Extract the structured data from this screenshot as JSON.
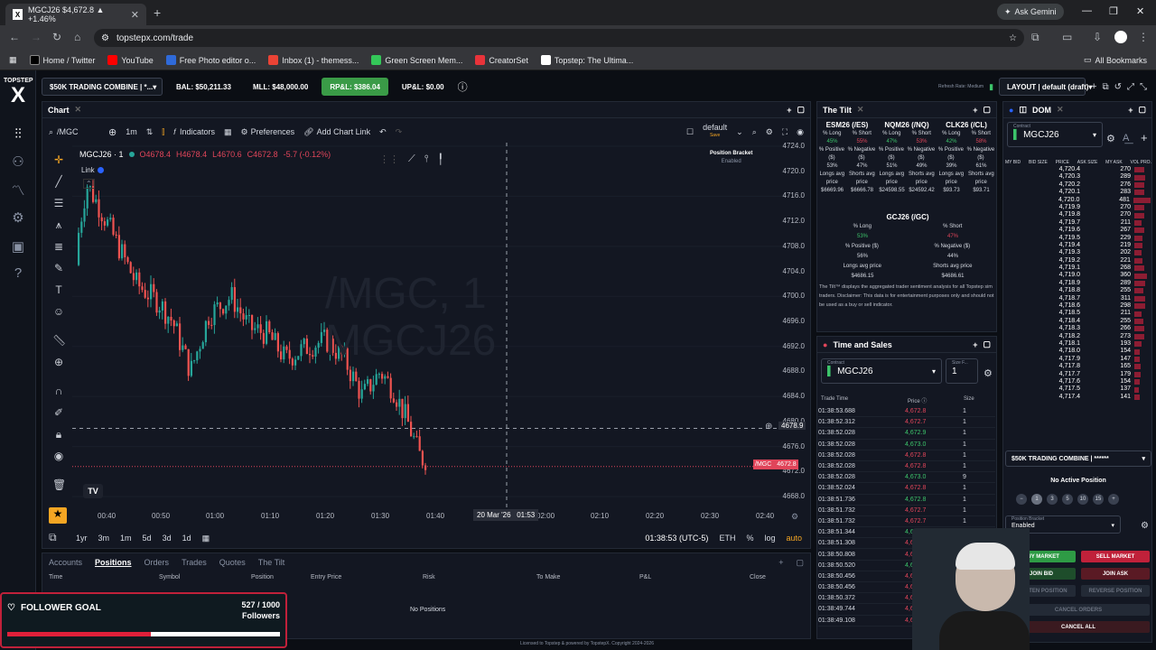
{
  "browser": {
    "tab_title": "MGCJ26 $4,672.8 ▲ +1.46%",
    "tab_icon": "X",
    "ask_gemini": "Ask Gemini",
    "url": "topstepx.com/trade",
    "bookmarks": [
      "Home / Twitter",
      "YouTube",
      "Free Photo editor o...",
      "Inbox (1) - themess...",
      "Green Screen Mem...",
      "CreatorSet",
      "Topstep: The Ultima..."
    ],
    "all_bookmarks": "All Bookmarks"
  },
  "app": {
    "logo_top": "TOPSTEP",
    "logo_x": "X",
    "account": "$50K TRADING COMBINE | *...",
    "bal": "BAL: $50,211.33",
    "mll": "MLL: $48,000.00",
    "rpl": "RP&L: $386.04",
    "upl": "UP&L: $0.00",
    "refresh": "Refresh Rate: Medium",
    "layout": "LAYOUT | default (draft)"
  },
  "chart": {
    "panel_title": "Chart",
    "symbol_search": "/MGC",
    "timeframe": "1m",
    "indicators": "Indicators",
    "preferences": "Preferences",
    "add_chart_link": "Add Chart Link",
    "layout_name": "default",
    "layout_save": "Save",
    "ohlc_symbol": "MGCJ26 · 1",
    "o": "O4678.4",
    "h": "H4678.4",
    "l": "L4670.6",
    "c": "C4672.8",
    "chg": "-5.7 (-0.12%)",
    "link": "Link",
    "watermark_line1": "/MGC, 1",
    "watermark_line2": "MGCJ26",
    "bracket_label": "Position Bracket",
    "bracket_state": "Enabled",
    "y_ticks": [
      "4724.0",
      "4720.0",
      "4716.0",
      "4712.0",
      "4708.0",
      "4704.0",
      "4700.0",
      "4696.0",
      "4692.0",
      "4688.0",
      "4684.0",
      "4680.0",
      "4676.0",
      "4672.0",
      "4668.0"
    ],
    "crosshair_price": "4678.9",
    "last_price_tag": "/MGC",
    "last_price": "4672.8",
    "x_ticks": [
      "00:40",
      "00:50",
      "01:00",
      "01:10",
      "01:20",
      "01:30",
      "01:40",
      "02:00",
      "02:10",
      "02:20",
      "02:30",
      "02:40"
    ],
    "crosshair_time": "20 Mar '26   01:53",
    "ranges": [
      "1yr",
      "3m",
      "1m",
      "5d",
      "3d",
      "1d"
    ],
    "clock": "01:38:53 (UTC-5)",
    "session": "ETH",
    "pct": "%",
    "log": "log",
    "auto": "auto"
  },
  "positions": {
    "tabs": [
      "Accounts",
      "Positions",
      "Orders",
      "Trades",
      "Quotes",
      "The Tilt"
    ],
    "columns": [
      "Time",
      "Symbol",
      "Position",
      "Entry Price",
      "Risk",
      "To Make",
      "P&L",
      "Close"
    ],
    "empty": "No Positions"
  },
  "follower": {
    "label": "FOLLOWER GOAL",
    "count": "527 / 1000",
    "unit": "Followers",
    "progress": 0.527
  },
  "license": "Licensed to Topstep & powered by TopstepX. Copyright 2024-2026",
  "tilt": {
    "title": "The Tilt",
    "cols": [
      {
        "name": "ESM26 (/ES)",
        "long_lbl": "% Long",
        "short_lbl": "% Short",
        "long": "45%",
        "short": "55%",
        "pos_lbl": "% Positive ($)",
        "neg_lbl": "% Negative ($)",
        "pos": "53%",
        "neg": "47%",
        "lavg_lbl": "Longs avg price",
        "savg_lbl": "Shorts avg price",
        "lavg": "$6669.96",
        "savg": "$6666.78"
      },
      {
        "name": "NQM26 (/NQ)",
        "long_lbl": "% Long",
        "short_lbl": "% Short",
        "long": "47%",
        "short": "53%",
        "pos_lbl": "% Positive ($)",
        "neg_lbl": "% Negative ($)",
        "pos": "51%",
        "neg": "49%",
        "lavg_lbl": "Longs avg price",
        "savg_lbl": "Shorts avg price",
        "lavg": "$24598.55",
        "savg": "$24592.42"
      },
      {
        "name": "CLK26 (/CL)",
        "long_lbl": "% Long",
        "short_lbl": "% Short",
        "long": "42%",
        "short": "58%",
        "pos_lbl": "% Positive ($)",
        "neg_lbl": "% Negative ($)",
        "pos": "39%",
        "neg": "61%",
        "lavg_lbl": "Longs avg price",
        "savg_lbl": "Shorts avg price",
        "lavg": "$93.73",
        "savg": "$93.71"
      }
    ],
    "gc": {
      "name": "GCJ26 (/GC)",
      "long_lbl": "% Long",
      "short_lbl": "% Short",
      "long": "53%",
      "short": "47%",
      "pos_lbl": "% Positive ($)",
      "neg_lbl": "% Negative ($)",
      "pos": "56%",
      "neg": "44%",
      "lavg_lbl": "Longs avg price",
      "savg_lbl": "Shorts avg price",
      "lavg": "$4686.15",
      "savg": "$4686.61"
    },
    "disclaimer": "The Tilt™ displays the aggregated trader sentiment analysis for all Topstep sim traders. Disclaimer: This data is for entertainment purposes only and should not be used as a buy or sell indicator."
  },
  "tas": {
    "title": "Time and Sales",
    "contract_lbl": "Contract",
    "contract": "MGCJ26",
    "size_lbl": "Size F...",
    "size": "1",
    "cols": [
      "Trade Time",
      "Price",
      "Size"
    ],
    "rows": [
      [
        "01:38:53.688",
        "4,672.8",
        "1",
        "r"
      ],
      [
        "01:38:52.312",
        "4,672.7",
        "1",
        "r"
      ],
      [
        "01:38:52.028",
        "4,672.9",
        "1",
        "g"
      ],
      [
        "01:38:52.028",
        "4,673.0",
        "1",
        "g"
      ],
      [
        "01:38:52.028",
        "4,672.8",
        "1",
        "r"
      ],
      [
        "01:38:52.028",
        "4,672.8",
        "1",
        "r"
      ],
      [
        "01:38:52.028",
        "4,673.0",
        "9",
        "g"
      ],
      [
        "01:38:52.024",
        "4,672.8",
        "1",
        "r"
      ],
      [
        "01:38:51.736",
        "4,672.8",
        "1",
        "g"
      ],
      [
        "01:38:51.732",
        "4,672.7",
        "1",
        "r"
      ],
      [
        "01:38:51.732",
        "4,672.7",
        "1",
        "r"
      ],
      [
        "01:38:51.344",
        "4,673.0",
        "1",
        "g"
      ],
      [
        "01:38:51.308",
        "4,672.9",
        "1",
        "r"
      ],
      [
        "01:38:50.808",
        "4,672.7",
        "1",
        "r"
      ],
      [
        "01:38:50.520",
        "4,672.8",
        "1",
        "g"
      ],
      [
        "01:38:50.456",
        "4,672.8",
        "1",
        "r"
      ],
      [
        "01:38:50.456",
        "4,672.6",
        "1",
        "r"
      ],
      [
        "01:38:50.372",
        "4,672.7",
        "1",
        "r"
      ],
      [
        "01:38:49.744",
        "4,672.6",
        "1",
        "r"
      ],
      [
        "01:38:49.108",
        "4,672.6",
        "1",
        "r"
      ]
    ]
  },
  "dom": {
    "title": "DOM",
    "contract_lbl": "Contract",
    "contract": "MGCJ26",
    "cols": [
      "MY BID",
      "BID SIZE",
      "PRICE",
      "ASK SIZE",
      "MY ASK",
      "VOL PRO."
    ],
    "rows": [
      [
        "4,720.4",
        "270"
      ],
      [
        "4,720.3",
        "289"
      ],
      [
        "4,720.2",
        "276"
      ],
      [
        "4,720.1",
        "283"
      ],
      [
        "4,720.0",
        "481"
      ],
      [
        "4,719.9",
        "270"
      ],
      [
        "4,719.8",
        "270"
      ],
      [
        "4,719.7",
        "211"
      ],
      [
        "4,719.6",
        "267"
      ],
      [
        "4,719.5",
        "229"
      ],
      [
        "4,719.4",
        "219"
      ],
      [
        "4,719.3",
        "202"
      ],
      [
        "4,719.2",
        "221"
      ],
      [
        "4,719.1",
        "268"
      ],
      [
        "4,719.0",
        "360"
      ],
      [
        "4,718.9",
        "289"
      ],
      [
        "4,718.8",
        "255"
      ],
      [
        "4,718.7",
        "311"
      ],
      [
        "4,718.6",
        "298"
      ],
      [
        "4,718.5",
        "211"
      ],
      [
        "4,718.4",
        "255"
      ],
      [
        "4,718.3",
        "266"
      ],
      [
        "4,718.2",
        "273"
      ],
      [
        "4,718.1",
        "193"
      ],
      [
        "4,718.0",
        "154"
      ],
      [
        "4,717.9",
        "147"
      ],
      [
        "4,717.8",
        "165"
      ],
      [
        "4,717.7",
        "179"
      ],
      [
        "4,717.6",
        "154"
      ],
      [
        "4,717.5",
        "137"
      ],
      [
        "4,717.4",
        "141"
      ]
    ],
    "account": "$50K TRADING COMBINE | ******",
    "no_position": "No Active Position",
    "qty": [
      "1",
      "3",
      "5",
      "10",
      "15"
    ],
    "bracket_lbl": "Position Bracket",
    "bracket": "Enabled",
    "buy": "BUY MARKET",
    "sell": "SELL MARKET",
    "join_bid": "JOIN BID",
    "join_ask": "JOIN ASK",
    "flatten": "FLATTEN POSITION",
    "reverse": "REVERSE POSITION",
    "cancel_orders": "CANCEL ORDERS",
    "cancel_all": "CANCEL ALL"
  },
  "colors": {
    "bull": "#26a69a",
    "bear": "#ef5350",
    "accent": "#3a9b47",
    "bg": "#131722"
  }
}
